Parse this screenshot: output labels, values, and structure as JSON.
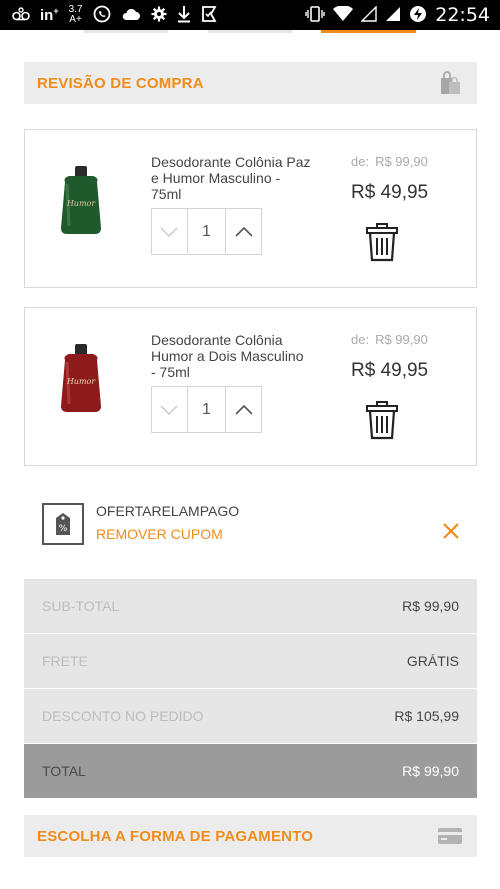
{
  "status_bar": {
    "network_label": "3.7\nA+",
    "time": "22:54"
  },
  "review": {
    "title": "REVISÃO DE COMPRA",
    "icon": "shopping-bags-icon"
  },
  "items": [
    {
      "name": "Desodorante Colônia Paz e Humor Masculino - 75ml",
      "from_label": "de:",
      "price_from": "R$ 99,90",
      "price": "R$ 49,95",
      "quantity": "1",
      "bottle_color": "#1f5a2c"
    },
    {
      "name": "Desodorante Colônia Humor a Dois Masculino - 75ml",
      "from_label": "de:",
      "price_from": "R$ 99,90",
      "price": "R$ 49,95",
      "quantity": "1",
      "bottle_color": "#8e1b1b"
    }
  ],
  "coupon": {
    "code": "OFERTARELAMPAGO",
    "remove_label": "REMOVER CUPOM"
  },
  "totals": {
    "subtotal_label": "SUB-TOTAL",
    "subtotal_value": "R$ 99,90",
    "shipping_label": "FRETE",
    "shipping_value": "GRÁTIS",
    "discount_label": "DESCONTO NO PEDIDO",
    "discount_value": "R$ 105,99",
    "total_label": "TOTAL",
    "total_value": "R$ 99,90"
  },
  "payment": {
    "title": "ESCOLHA A FORMA DE PAGAMENTO",
    "icon": "credit-card-icon"
  },
  "colors": {
    "accent": "#f08c1a",
    "header_bg": "#ececec",
    "total_bg": "#9b9b9b"
  }
}
